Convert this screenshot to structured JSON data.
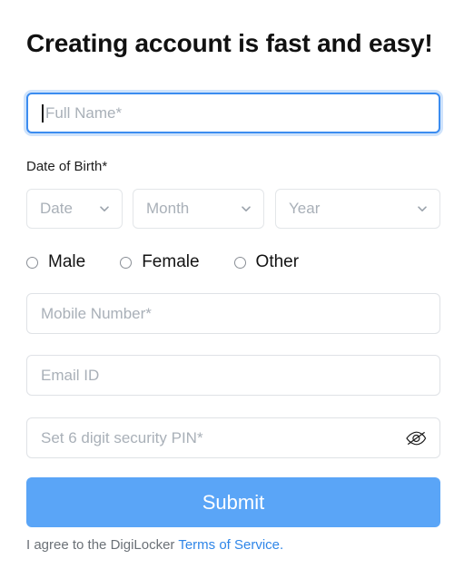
{
  "form": {
    "heading": "Creating account is fast and easy!",
    "full_name": {
      "placeholder": "Full Name*",
      "value": "",
      "focused": true
    },
    "date_of_birth": {
      "label": "Date of Birth*",
      "selects": [
        {
          "name": "date",
          "selected": "Date",
          "icon": "chevron-down-icon"
        },
        {
          "name": "month",
          "selected": "Month",
          "icon": "chevron-down-icon"
        },
        {
          "name": "year",
          "selected": "Year",
          "icon": "chevron-down-icon"
        }
      ]
    },
    "gender": {
      "options": [
        {
          "label": "Male",
          "selected": false
        },
        {
          "label": "Female",
          "selected": false
        },
        {
          "label": "Other",
          "selected": false
        }
      ]
    },
    "mobile": {
      "placeholder": "Mobile Number*",
      "value": ""
    },
    "email": {
      "placeholder": "Email ID",
      "value": ""
    },
    "pin": {
      "placeholder": "Set 6 digit security PIN*",
      "value": "",
      "toggle_icon": "eye-off-icon"
    },
    "submit_label": "Submit",
    "terms": {
      "prefix": "I agree to the DigiLocker ",
      "link": "Terms of Service",
      "suffix": "."
    }
  },
  "colors": {
    "accent": "#5aa5f7",
    "link": "#2f86e8",
    "focus_border": "#3b8cf0",
    "focus_ring": "#cfe3fb",
    "border": "#dfe2e6",
    "placeholder": "#a9b0b8",
    "text": "#111111",
    "muted_text": "#6b7177"
  }
}
